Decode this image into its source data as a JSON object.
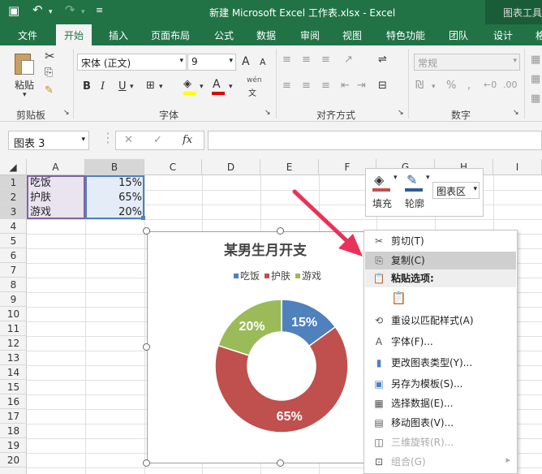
{
  "titlebar": {
    "title": "新建 Microsoft Excel 工作表.xlsx - Excel",
    "context_tab": "图表工具",
    "save_icon": "save-icon",
    "undo_icon": "undo-icon",
    "redo_icon": "redo-icon"
  },
  "tabs": [
    "文件",
    "开始",
    "插入",
    "页面布局",
    "公式",
    "数据",
    "审阅",
    "视图",
    "特色功能",
    "团队",
    "设计",
    "格"
  ],
  "ribbon": {
    "paste_label": "粘贴",
    "clipboard_label": "剪贴板",
    "font_name": "宋体 (正文)",
    "font_size": "9",
    "font_group_label": "字体",
    "align_group_label": "对齐方式",
    "number_format": "常规",
    "number_group_label": "数字",
    "bold": "B",
    "italic": "I",
    "underline": "U",
    "grow_font": "A",
    "shrink_font": "A",
    "wen": "wén",
    "percent": "%"
  },
  "formula_bar": {
    "name_box": "图表 3",
    "fx": "fx",
    "cancel": "✕",
    "enter": "✓",
    "content": ""
  },
  "sheet": {
    "columns": [
      "A",
      "B",
      "C",
      "D",
      "E",
      "F",
      "G",
      "H",
      "I"
    ],
    "rows": [
      "1",
      "2",
      "3",
      "4",
      "5",
      "6",
      "7",
      "8",
      "9",
      "10",
      "11",
      "12",
      "13",
      "14",
      "15",
      "16",
      "17",
      "18",
      "19",
      "20"
    ],
    "data": [
      {
        "label": "吃饭",
        "value": "15%"
      },
      {
        "label": "护肤",
        "value": "65%"
      },
      {
        "label": "游戏",
        "value": "20%"
      }
    ]
  },
  "chart_data": {
    "type": "pie",
    "title": "某男生月开支",
    "donut": true,
    "categories": [
      "吃饭",
      "护肤",
      "游戏"
    ],
    "values": [
      15,
      65,
      20
    ],
    "labels": [
      "15%",
      "65%",
      "20%"
    ],
    "colors": [
      "#4f81bd",
      "#c0504d",
      "#9bbb59"
    ],
    "legend": "top"
  },
  "minibar": {
    "fill_label": "填充",
    "outline_label": "轮廓",
    "element_select": "图表区"
  },
  "context_menu": [
    {
      "label": "剪切(T)",
      "icon": "scissors-icon"
    },
    {
      "label": "复制(C)",
      "icon": "copy-icon",
      "highlighted": true
    },
    {
      "label": "粘贴选项:",
      "icon": "paste-icon",
      "header": true
    },
    {
      "label": "",
      "icon": "paste-option-icon"
    },
    {
      "label": "重设以匹配样式(A)",
      "icon": "reset-style-icon"
    },
    {
      "label": "字体(F)...",
      "icon": "font-icon"
    },
    {
      "label": "更改图表类型(Y)...",
      "icon": "chart-type-icon"
    },
    {
      "label": "另存为模板(S)...",
      "icon": "save-template-icon"
    },
    {
      "label": "选择数据(E)...",
      "icon": "select-data-icon"
    },
    {
      "label": "移动图表(V)...",
      "icon": "move-chart-icon"
    },
    {
      "label": "三维旋转(R)...",
      "icon": "3d-rotate-icon",
      "disabled": true
    },
    {
      "label": "组合(G)",
      "icon": "group-icon",
      "disabled": true
    }
  ],
  "colors": {
    "excel_green": "#217346",
    "arrow": "#e8325a"
  }
}
